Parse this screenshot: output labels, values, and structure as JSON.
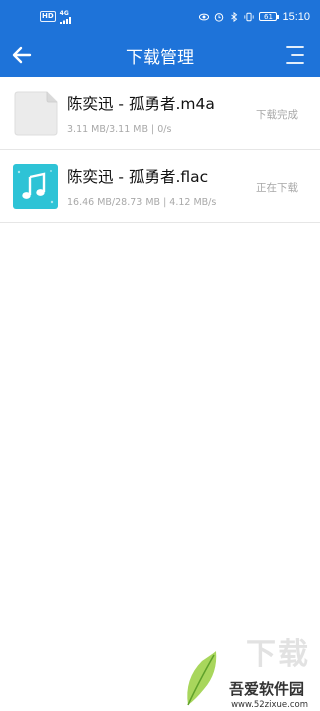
{
  "status_bar": {
    "hd_label": "HD",
    "network_label": "4G",
    "battery_level": "61",
    "time": "15:10",
    "icons": [
      "eye-icon",
      "alarm-icon",
      "bluetooth-icon",
      "vibrate-icon",
      "battery-icon"
    ]
  },
  "header": {
    "title": "下载管理",
    "back_icon": "arrow-left-icon",
    "menu_icon": "menu-icon",
    "background_color": "#1e73d9"
  },
  "downloads": [
    {
      "name": "陈奕迅 - 孤勇者.m4a",
      "meta": "3.11 MB/3.11 MB | 0/s",
      "status": "下载完成",
      "icon": "blank-file-icon"
    },
    {
      "name": "陈奕迅 - 孤勇者.flac",
      "meta": "16.46 MB/28.73 MB | 4.12 MB/s",
      "status": "正在下载",
      "icon": "music-file-icon",
      "icon_color": "#2ec3d6"
    }
  ],
  "watermark": {
    "big_text": "下载",
    "name": "吾爱软件园",
    "url": "www.52zixue.com"
  }
}
